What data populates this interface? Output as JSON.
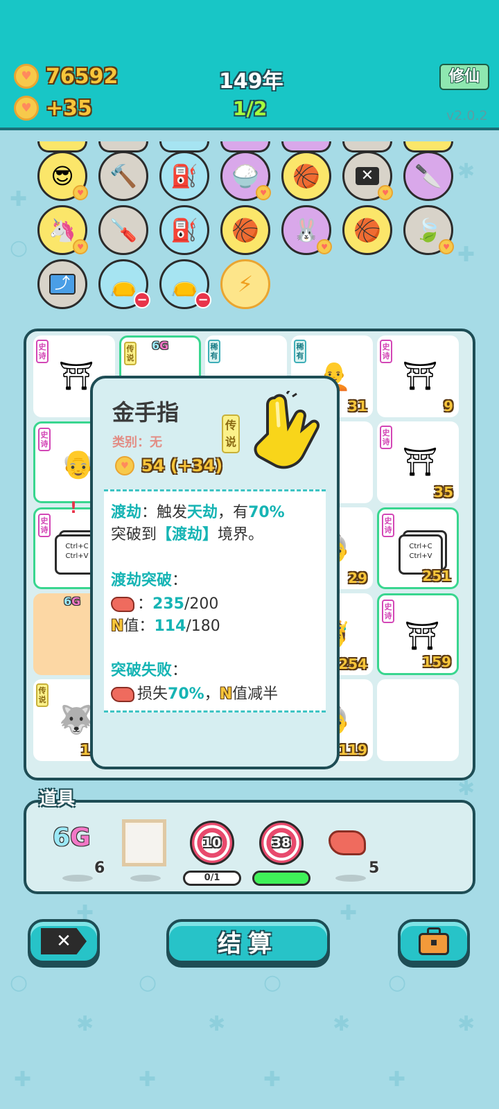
{
  "header": {
    "coins": "76592",
    "coin_rate": "+35",
    "year": "149年",
    "round": "1/2",
    "cultivate_button": "修仙",
    "version": "v2.0.2"
  },
  "board_cards": [
    {
      "tag": "史诗",
      "num": ""
    },
    {
      "tag": "传说",
      "num": ""
    },
    {
      "tag": "稀有",
      "num": ""
    },
    {
      "tag": "稀有",
      "num": "31"
    },
    {
      "tag": "史诗",
      "num": "9"
    },
    {
      "tag": "史诗",
      "num": ""
    },
    {
      "tag": "史诗",
      "num": "35"
    },
    {
      "tag": "史诗",
      "num": ""
    },
    {
      "num": "29"
    },
    {
      "tag": "史诗",
      "num": "251"
    },
    {
      "num": "254"
    },
    {
      "tag": "史诗",
      "num": "159"
    },
    {
      "tag": "传说",
      "num": "152"
    },
    {
      "num": "119"
    }
  ],
  "copy_label": {
    "line1": "Ctrl+C",
    "line2": "Ctrl+V"
  },
  "six_g": {
    "six": "6",
    "g": "G"
  },
  "popup": {
    "title": "金手指",
    "category": "类别：无",
    "tag": "传说",
    "price": "54 (+34)",
    "desc_a": "渡劫",
    "desc_b": "：触发",
    "desc_c": "天劫",
    "desc_d": "，有",
    "desc_e": "70%",
    "desc_f": "突破到",
    "desc_g": "【渡劫】",
    "desc_h": "境界。",
    "break_title": "渡劫突破",
    "colon": "：",
    "liver_colon": "：",
    "liver_have": "235",
    "liver_need": "/200",
    "n_letter": "N",
    "n_label": "值：",
    "n_have": "114",
    "n_need": "/180",
    "fail_title": "突破失败",
    "fail_a": "损失",
    "fail_b": "70%",
    "fail_c": "，",
    "fail_d": "值减半"
  },
  "props": {
    "title": "道具",
    "sixg_count": "6",
    "target1": "10",
    "target1_progress": "0/1",
    "target2": "38",
    "liver_count": "5"
  },
  "progress": {
    "target1": 0.0,
    "target2": 1.0
  },
  "buttons": {
    "settle": "结算"
  },
  "colors": {
    "header": "#18c6c6",
    "background": "#a6dbe6",
    "accent_gold": "#f8c53a",
    "teal": "#16b4b4"
  }
}
